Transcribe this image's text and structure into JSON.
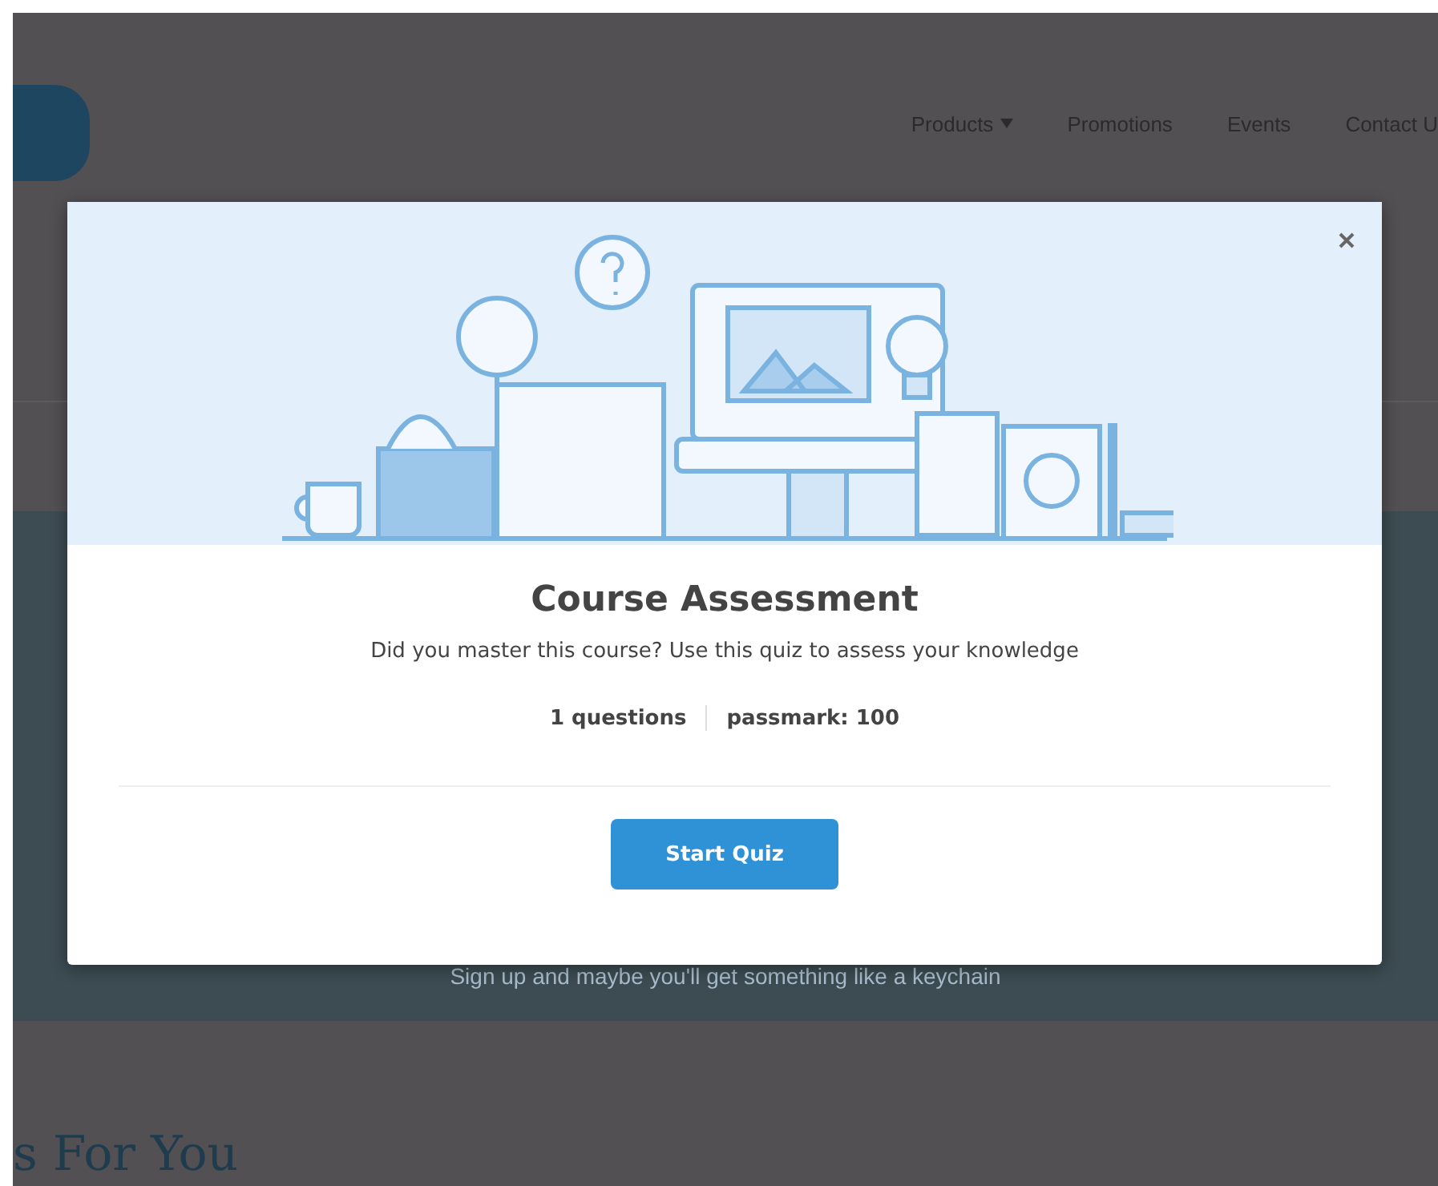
{
  "page": {
    "nav": [
      {
        "label": "Products",
        "has_caret": true
      },
      {
        "label": "Promotions",
        "has_caret": false
      },
      {
        "label": "Events",
        "has_caret": false
      },
      {
        "label": "Contact U",
        "has_caret": false
      }
    ],
    "banner_text": "Sign up and maybe you'll get something like a keychain",
    "section_heading": "s For You"
  },
  "modal": {
    "title": "Course Assessment",
    "description": "Did you master this course? Use this quiz to assess your knowledge",
    "stats": [
      "1 questions",
      "passmark: 100"
    ],
    "button": "Start Quiz"
  }
}
